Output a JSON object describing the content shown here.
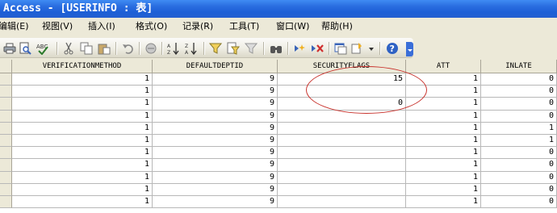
{
  "window": {
    "title": "Access - [USERINFO : 表]"
  },
  "menu": {
    "items": [
      {
        "label": "编辑(E)"
      },
      {
        "label": "视图(V)"
      },
      {
        "label": "插入(I)"
      },
      {
        "label": "格式(O)"
      },
      {
        "label": "记录(R)"
      },
      {
        "label": "工具(T)"
      },
      {
        "label": "窗口(W)"
      },
      {
        "label": "帮助(H)"
      }
    ]
  },
  "toolbar": {
    "buttons": [
      {
        "icon": "print-icon"
      },
      {
        "icon": "print-preview-icon"
      },
      {
        "icon": "spelling-icon"
      },
      {
        "icon": "cut-icon"
      },
      {
        "icon": "copy-icon"
      },
      {
        "icon": "paste-icon"
      },
      {
        "icon": "undo-icon"
      },
      {
        "icon": "insert-hyperlink-icon"
      },
      {
        "icon": "sort-ascending-icon"
      },
      {
        "icon": "sort-descending-icon"
      },
      {
        "icon": "filter-by-selection-icon"
      },
      {
        "icon": "filter-by-form-icon"
      },
      {
        "icon": "apply-filter-icon"
      },
      {
        "icon": "find-icon"
      },
      {
        "icon": "new-record-icon"
      },
      {
        "icon": "delete-record-icon"
      },
      {
        "icon": "database-window-icon"
      },
      {
        "icon": "new-object-icon"
      },
      {
        "icon": "help-icon"
      }
    ]
  },
  "table": {
    "columns": [
      "VERIFICATIONMETHOD",
      "DEFAULTDEPTID",
      "SECURITYFLAGS",
      "ATT",
      "INLATE"
    ],
    "rows": [
      [
        "1",
        "9",
        "15",
        "1",
        "0"
      ],
      [
        "1",
        "9",
        "",
        "1",
        "0"
      ],
      [
        "1",
        "9",
        "0",
        "1",
        "0"
      ],
      [
        "1",
        "9",
        "",
        "1",
        "0"
      ],
      [
        "1",
        "9",
        "",
        "1",
        "1"
      ],
      [
        "1",
        "9",
        "",
        "1",
        "1"
      ],
      [
        "1",
        "9",
        "",
        "1",
        "0"
      ],
      [
        "1",
        "9",
        "",
        "1",
        "0"
      ],
      [
        "1",
        "9",
        "",
        "1",
        "0"
      ],
      [
        "1",
        "9",
        "",
        "1",
        "0"
      ],
      [
        "1",
        "9",
        "",
        "1",
        "0"
      ]
    ]
  },
  "annotation": {
    "color": "#c8322c"
  }
}
